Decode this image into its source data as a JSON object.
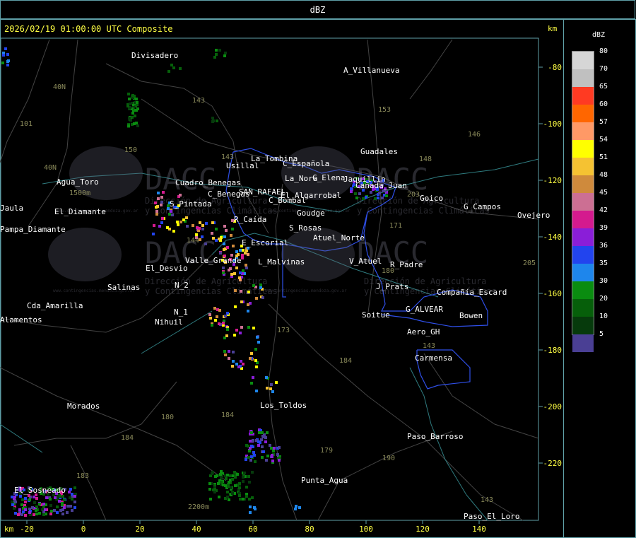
{
  "header": {
    "title": "dBZ"
  },
  "map": {
    "title": "2026/02/19 01:00:00 UTC Composite",
    "km_unit": "km",
    "x_ticks": [
      "-20",
      "0",
      "20",
      "40",
      "60",
      "80",
      "100",
      "120",
      "140"
    ],
    "y_ticks": [
      "-80",
      "-100",
      "-120",
      "-140",
      "-160",
      "-180",
      "-200",
      "-220"
    ],
    "places": [
      "Divisadero",
      "A_Villanueva",
      "Guadales",
      "Goico",
      "G_Campos",
      "Ovejero",
      "Agua_Toro",
      "El_Diamante",
      "Jaula",
      "Pampa_Diamante",
      "Usillal",
      "La_Tombina",
      "C_Española",
      "La_Nora",
      "C_Elena",
      "Jaquillin",
      "Cañada_Juan",
      "C_Benegas",
      "SAN_RAFAEL",
      "El_Algarrobal",
      "C_Bombal",
      "R_Caída",
      "Goudge",
      "S_Rosas",
      "Atuel_Norte",
      "E_Escorial",
      "Valle_Grande",
      "L_Malvinas",
      "V_Atuel",
      "R_Padre",
      "El_Desvio",
      "Salinas",
      "N_2",
      "N_1",
      "Nihuil",
      "Cda_Amarilla",
      "Alamentos",
      "Bowen",
      "Compañía_Escard",
      "G_ALVEAR",
      "Soitue",
      "Aero_GH",
      "Carmensa",
      "Los_Toldos",
      "Morados",
      "Paso_Barroso",
      "Punta_Agua",
      "Paso_El_Loro",
      "El_Sosneado",
      "S_Pintada",
      "Cuadro_Benegas",
      "J_Prats"
    ],
    "road_labels": [
      "143",
      "153",
      "146",
      "148",
      "203",
      "171",
      "101",
      "40N",
      "40N",
      "150",
      "143",
      "180",
      "173",
      "184",
      "184",
      "184",
      "179",
      "190",
      "143",
      "183",
      "180",
      "143",
      "205",
      "144",
      "1500m",
      "2200m"
    ],
    "watermark": {
      "brand": "DACC",
      "subtitle1": "Dirección de Agricultura",
      "subtitle2": "y Contingencias Climáticas",
      "url": "www.contingencias.mendoza.gov.ar"
    }
  },
  "legend": {
    "title": "dBZ",
    "levels": [
      {
        "label": "80",
        "color": "#d6d6d6"
      },
      {
        "label": "70",
        "color": "#c0c0c0"
      },
      {
        "label": "65",
        "color": "#ff3a22"
      },
      {
        "label": "60",
        "color": "#ff6600"
      },
      {
        "label": "57",
        "color": "#ff9966"
      },
      {
        "label": "54",
        "color": "#ffff00"
      },
      {
        "label": "51",
        "color": "#f5c232"
      },
      {
        "label": "48",
        "color": "#cf8a3c"
      },
      {
        "label": "45",
        "color": "#cc6f93"
      },
      {
        "label": "42",
        "color": "#d41a8e"
      },
      {
        "label": "39",
        "color": "#8a1ed8"
      },
      {
        "label": "36",
        "color": "#2244ee"
      },
      {
        "label": "35",
        "color": "#1e86ec"
      },
      {
        "label": "30",
        "color": "#0a8c10"
      },
      {
        "label": "20",
        "color": "#065f0a"
      },
      {
        "label": "10",
        "color": "#063a0c"
      },
      {
        "label": "5",
        "color": "#4a3f94"
      }
    ]
  }
}
